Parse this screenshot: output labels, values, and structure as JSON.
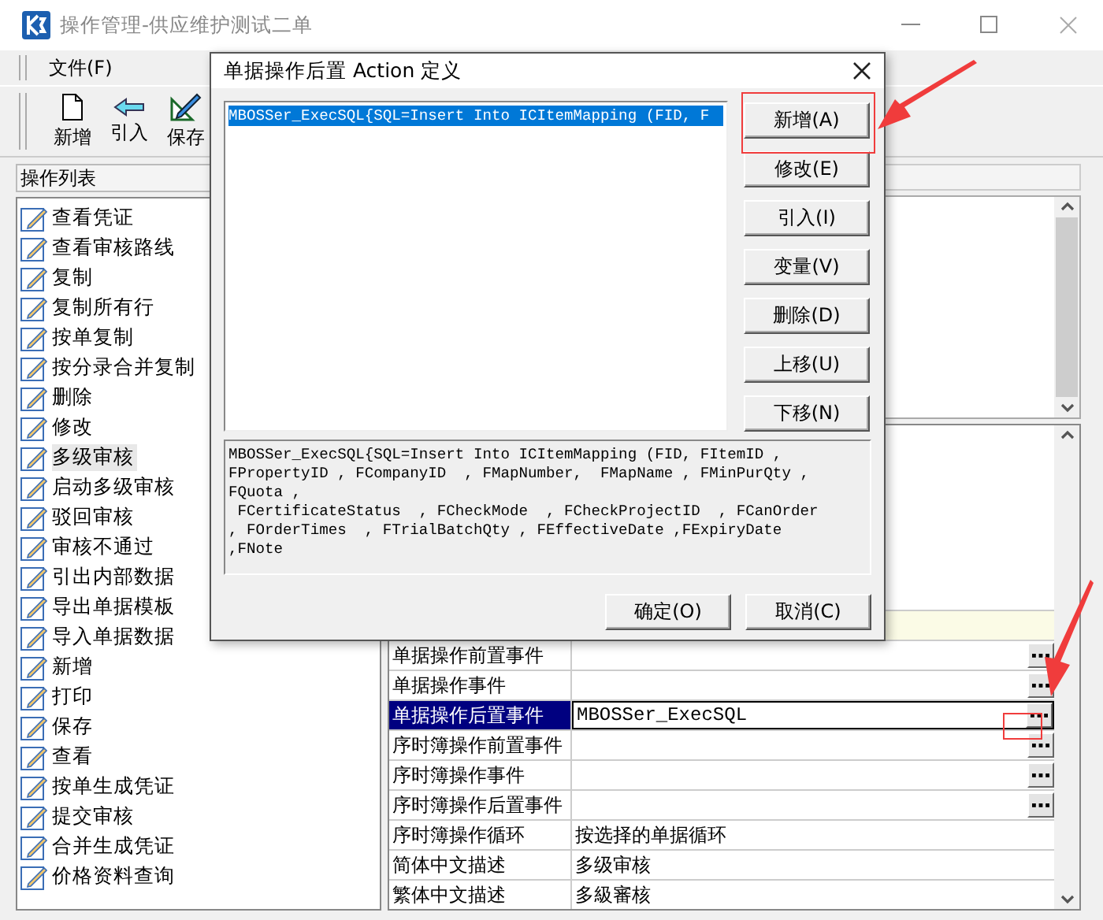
{
  "window": {
    "title": "操作管理-供应维护测试二单"
  },
  "menu": [
    {
      "label": "文件(F)"
    }
  ],
  "toolbar": [
    {
      "label": "新增",
      "kind": "new"
    },
    {
      "label": "引入",
      "kind": "import"
    },
    {
      "label": "保存",
      "kind": "save"
    }
  ],
  "operation_list": {
    "title": "操作列表",
    "items": [
      {
        "label": "查看凭证",
        "selected": false
      },
      {
        "label": "查看审核路线",
        "selected": false
      },
      {
        "label": "复制",
        "selected": false
      },
      {
        "label": "复制所有行",
        "selected": false
      },
      {
        "label": "按单复制",
        "selected": false
      },
      {
        "label": "按分录合并复制",
        "selected": false
      },
      {
        "label": "删除",
        "selected": false
      },
      {
        "label": "修改",
        "selected": false
      },
      {
        "label": "多级审核",
        "selected": true
      },
      {
        "label": "启动多级审核",
        "selected": false
      },
      {
        "label": "驳回审核",
        "selected": false
      },
      {
        "label": "审核不通过",
        "selected": false
      },
      {
        "label": "引出内部数据",
        "selected": false
      },
      {
        "label": "导出单据模板",
        "selected": false
      },
      {
        "label": "导入单据数据",
        "selected": false
      },
      {
        "label": "新增",
        "selected": false
      },
      {
        "label": "打印",
        "selected": false
      },
      {
        "label": "保存",
        "selected": false
      },
      {
        "label": "查看",
        "selected": false
      },
      {
        "label": "按单生成凭证",
        "selected": false
      },
      {
        "label": "提交审核",
        "selected": false
      },
      {
        "label": "合并生成凭证",
        "selected": false
      },
      {
        "label": "价格资料查询",
        "selected": false
      }
    ]
  },
  "properties": [
    {
      "name": "单据操作前置事件",
      "ellipsis": true,
      "selected": false
    },
    {
      "name": "单据操作事件",
      "ellipsis": true,
      "selected": false
    },
    {
      "name": "单据操作后置事件",
      "value": "MBOSSer_ExecSQL",
      "ellipsis": true,
      "selected": true
    },
    {
      "name": "序时簿操作前置事件",
      "ellipsis": true,
      "selected": false
    },
    {
      "name": "序时簿操作事件",
      "ellipsis": true,
      "selected": false
    },
    {
      "name": "序时簿操作后置事件",
      "ellipsis": true,
      "selected": false
    },
    {
      "name": "序时簿操作循环",
      "value": "按选择的单据循环",
      "ellipsis": false,
      "selected": false
    },
    {
      "name": "简体中文描述",
      "value": "多级审核",
      "ellipsis": false,
      "selected": false
    },
    {
      "name": "繁体中文描述",
      "value": "多級審核",
      "ellipsis": false,
      "selected": false
    }
  ],
  "dialog": {
    "title": "单据操作后置 Action 定义",
    "actions": [
      {
        "text": "MBOSSer_ExecSQL{SQL=Insert Into ICItemMapping (FID, F",
        "selected": true
      }
    ],
    "side_buttons": [
      {
        "label": "新增(A)"
      },
      {
        "label": "修改(E)"
      },
      {
        "label": "引入(I)"
      },
      {
        "label": "变量(V)"
      },
      {
        "label": "删除(D)"
      },
      {
        "label": "上移(U)"
      },
      {
        "label": "下移(N)"
      }
    ],
    "detail": "MBOSSer_ExecSQL{SQL=Insert Into ICItemMapping (FID, FItemID ,\nFPropertyID , FCompanyID  , FMapNumber,  FMapName , FMinPurQty ,\nFQuota ,\n FCertificateStatus  , FCheckMode  , FCheckProjectID  , FCanOrder\n, FOrderTimes  , FTrialBatchQty , FEffectiveDate ,FExpiryDate\n,FNote",
    "buttons": [
      {
        "label": "确定(O)"
      },
      {
        "label": "取消(C)"
      }
    ]
  }
}
